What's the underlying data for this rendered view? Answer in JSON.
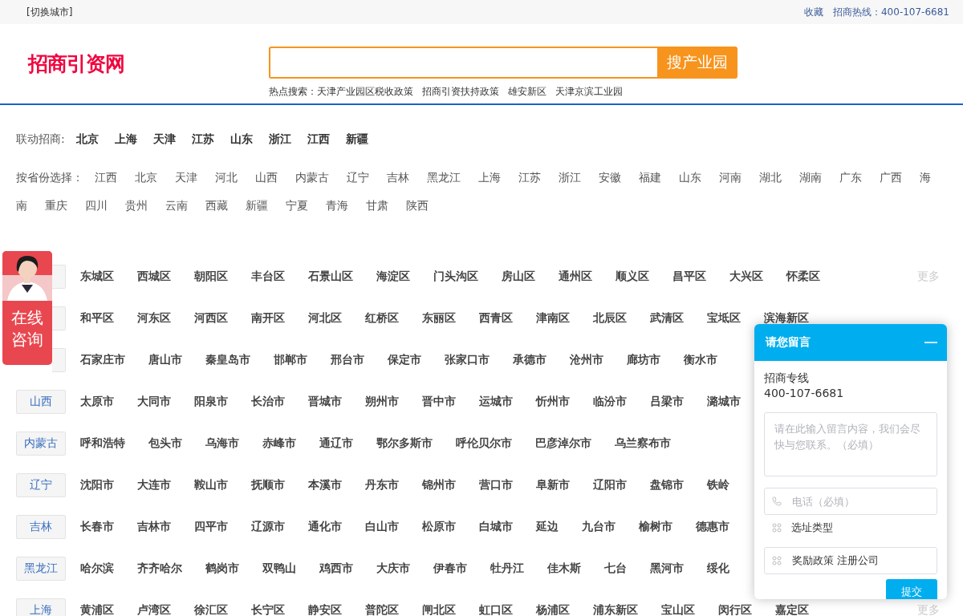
{
  "top_bar": {
    "switch_city": "[切换城市]",
    "favorite": "收藏",
    "hotline": "招商热线：400-107-6681"
  },
  "header": {
    "logo": "招商引资网",
    "search": {
      "button": "搜产业园"
    },
    "hot_label": "热点搜索：",
    "hot_links": [
      "天津产业园区税收政策",
      "招商引资扶持政策",
      "雄安新区",
      "天津京滨工业园"
    ]
  },
  "linked": {
    "label": "联动招商:",
    "items": [
      "北京",
      "上海",
      "天津",
      "江苏",
      "山东",
      "浙江",
      "江西",
      "新疆"
    ]
  },
  "provinces": {
    "label": "按省份选择：",
    "items": [
      "江西",
      "北京",
      "天津",
      "河北",
      "山西",
      "内蒙古",
      "辽宁",
      "吉林",
      "黑龙江",
      "上海",
      "江苏",
      "浙江",
      "安徽",
      "福建",
      "山东",
      "河南",
      "湖北",
      "湖南",
      "广东",
      "广西",
      "海",
      "南",
      "重庆",
      "四川",
      "贵州",
      "云南",
      "西藏",
      "新疆",
      "宁夏",
      "青海",
      "甘肃",
      "陕西"
    ]
  },
  "city_rows": [
    {
      "cities": [
        "东城区",
        "西城区",
        "朝阳区",
        "丰台区",
        "石景山区",
        "海淀区",
        "门头沟区",
        "房山区",
        "通州区",
        "顺义区",
        "昌平区",
        "大兴区",
        "怀柔区"
      ],
      "more": "更多"
    },
    {
      "cities": [
        "和平区",
        "河东区",
        "河西区",
        "南开区",
        "河北区",
        "红桥区",
        "东丽区",
        "西青区",
        "津南区",
        "北辰区",
        "武清区",
        "宝坻区",
        "滨海新区"
      ]
    },
    {
      "cities": [
        "石家庄市",
        "唐山市",
        "秦皇岛市",
        "邯郸市",
        "邢台市",
        "保定市",
        "张家口市",
        "承德市",
        "沧州市",
        "廊坊市",
        "衡水市"
      ]
    },
    {
      "province": "山西",
      "cities": [
        "太原市",
        "大同市",
        "阳泉市",
        "长治市",
        "晋城市",
        "朔州市",
        "晋中市",
        "运城市",
        "忻州市",
        "临汾市",
        "吕梁市",
        "潞城市"
      ]
    },
    {
      "province": "内蒙古",
      "cities": [
        "呼和浩特",
        "包头市",
        "乌海市",
        "赤峰市",
        "通辽市",
        "鄂尔多斯市",
        "呼伦贝尔市",
        "巴彦淖尔市",
        "乌兰察布市"
      ]
    },
    {
      "province": "辽宁",
      "cities": [
        "沈阳市",
        "大连市",
        "鞍山市",
        "抚顺市",
        "本溪市",
        "丹东市",
        "锦州市",
        "营口市",
        "阜新市",
        "辽阳市",
        "盘锦市",
        "铁岭"
      ]
    },
    {
      "province": "吉林",
      "cities": [
        "长春市",
        "吉林市",
        "四平市",
        "辽源市",
        "通化市",
        "白山市",
        "松原市",
        "白城市",
        "延边",
        "九台市",
        "榆树市",
        "德惠市"
      ]
    },
    {
      "province": "黑龙江",
      "cities": [
        "哈尔滨",
        "齐齐哈尔",
        "鹤岗市",
        "双鸭山",
        "鸡西市",
        "大庆市",
        "伊春市",
        "牡丹江",
        "佳木斯",
        "七台",
        "黑河市",
        "绥化"
      ]
    },
    {
      "province": "上海",
      "cities": [
        "黄浦区",
        "卢湾区",
        "徐汇区",
        "长宁区",
        "静安区",
        "普陀区",
        "闸北区",
        "虹口区",
        "杨浦区",
        "浦东新区",
        "宝山区",
        "闵行区",
        "嘉定区"
      ],
      "more": "更多"
    }
  ],
  "consult_badge": {
    "label": "在线咨询"
  },
  "message_panel": {
    "title": "请您留言",
    "line_label": "招商专线",
    "line_number": "400-107-6681",
    "message_placeholder": "请在此输入留言内容，我们会尽快与您联系。（必填）",
    "phone_placeholder": "电话（必填）",
    "type_label": "选址类型",
    "type_value": "奖励政策 注册公司",
    "submit": "提交"
  }
}
